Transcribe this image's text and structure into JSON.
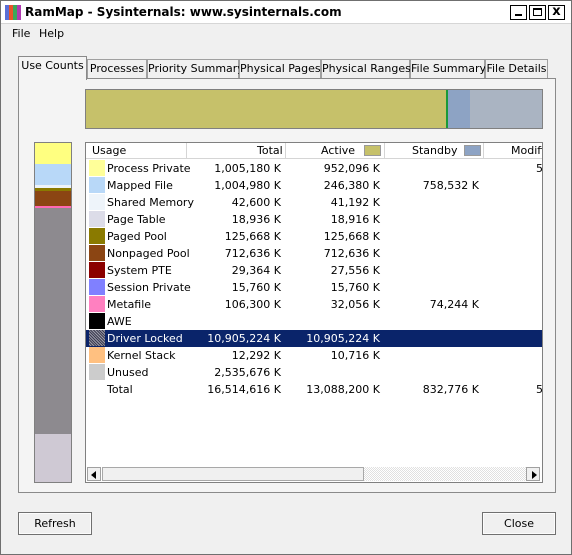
{
  "window": {
    "title": "RamMap - Sysinternals: www.sysinternals.com",
    "icon_colors": [
      "#5b6fd6",
      "#e8542a",
      "#3aa85a",
      "#b13ab0"
    ],
    "caption_buttons": [
      "minimize-icon",
      "maximize-icon",
      "close-icon"
    ],
    "close_glyph": "x"
  },
  "menu": {
    "file": "File",
    "help": "Help"
  },
  "tabs": [
    {
      "label": "Use Counts",
      "active": true
    },
    {
      "label": "Processes",
      "active": false
    },
    {
      "label": "Priority Summary",
      "active": false
    },
    {
      "label": "Physical Pages",
      "active": false
    },
    {
      "label": "Physical Ranges",
      "active": false
    },
    {
      "label": "File Summary",
      "active": false
    },
    {
      "label": "File Details",
      "active": false
    }
  ],
  "summary_bar": {
    "segments": [
      {
        "name": "Active",
        "color": "#c6c16a"
      },
      {
        "name": "Standby",
        "color": "#8da3c4"
      },
      {
        "name": "Modified",
        "color": "#bfbfbf"
      }
    ]
  },
  "usage_bar": {
    "segments": [
      {
        "name": "Process Private",
        "color": "#ffff80"
      },
      {
        "name": "Mapped File",
        "color": "#b8d8f8"
      },
      {
        "name": "Shared Memory",
        "color": "#eef4fa"
      },
      {
        "name": "Paged Pool",
        "color": "#8a7a00"
      },
      {
        "name": "Nonpaged Pool",
        "color": "#8b4513"
      },
      {
        "name": "Metafile",
        "color": "#ff69b4"
      },
      {
        "name": "Driver Locked",
        "color": "#8d8a8f"
      },
      {
        "name": "Unused",
        "color": "#cfc9d4"
      }
    ]
  },
  "table": {
    "columns": [
      {
        "label": "Usage",
        "swatch": null
      },
      {
        "label": "Total",
        "swatch": null
      },
      {
        "label": "Active",
        "swatch": "#c6c16a"
      },
      {
        "label": "Standby",
        "swatch": "#8da3c4"
      },
      {
        "label": "Modified",
        "swatch": null
      }
    ],
    "rows": [
      {
        "usage": "Process Private",
        "color": "#ffff99",
        "total": "1,005,180 K",
        "active": "952,096 K",
        "standby": "",
        "modified": "5"
      },
      {
        "usage": "Mapped File",
        "color": "#b8d8f8",
        "total": "1,004,980 K",
        "active": "246,380 K",
        "standby": "758,532 K",
        "modified": ""
      },
      {
        "usage": "Shared Memory",
        "color": "#eef4fa",
        "total": "42,600 K",
        "active": "41,192 K",
        "standby": "",
        "modified": ""
      },
      {
        "usage": "Page Table",
        "color": "#dcdce8",
        "total": "18,936 K",
        "active": "18,916 K",
        "standby": "",
        "modified": ""
      },
      {
        "usage": "Paged Pool",
        "color": "#8a7a00",
        "total": "125,668 K",
        "active": "125,668 K",
        "standby": "",
        "modified": ""
      },
      {
        "usage": "Nonpaged Pool",
        "color": "#8b4513",
        "total": "712,636 K",
        "active": "712,636 K",
        "standby": "",
        "modified": ""
      },
      {
        "usage": "System PTE",
        "color": "#8b0000",
        "total": "29,364 K",
        "active": "27,556 K",
        "standby": "",
        "modified": ""
      },
      {
        "usage": "Session Private",
        "color": "#8080ff",
        "total": "15,760 K",
        "active": "15,760 K",
        "standby": "",
        "modified": ""
      },
      {
        "usage": "Metafile",
        "color": "#ff80c0",
        "total": "106,300 K",
        "active": "32,056 K",
        "standby": "74,244 K",
        "modified": ""
      },
      {
        "usage": "AWE",
        "color": "#000000",
        "total": "",
        "active": "",
        "standby": "",
        "modified": ""
      },
      {
        "usage": "Driver Locked",
        "color": "#6e6e78",
        "total": "10,905,224 K",
        "active": "10,905,224 K",
        "standby": "",
        "modified": "",
        "selected": true
      },
      {
        "usage": "Kernel Stack",
        "color": "#ffc080",
        "total": "12,292 K",
        "active": "10,716 K",
        "standby": "",
        "modified": ""
      },
      {
        "usage": "Unused",
        "color": "#cccccc",
        "total": "2,535,676 K",
        "active": "",
        "standby": "",
        "modified": ""
      },
      {
        "usage": "Total",
        "color": "",
        "total": "16,514,616 K",
        "active": "13,088,200 K",
        "standby": "832,776 K",
        "modified": "5"
      }
    ]
  },
  "buttons": {
    "refresh": "Refresh",
    "close": "Close"
  }
}
